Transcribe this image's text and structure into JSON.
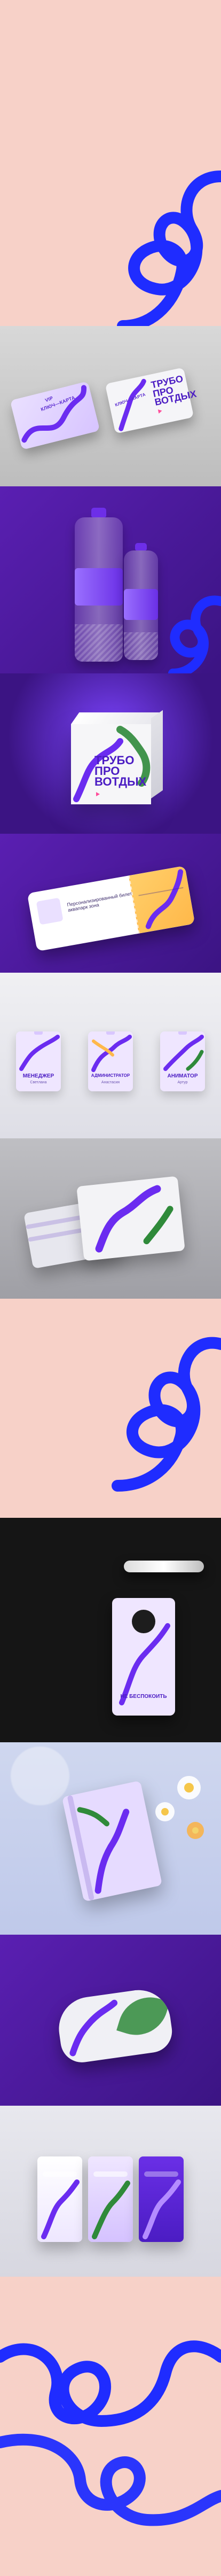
{
  "sections": {
    "cards": {
      "vip_label": "VIP",
      "key_card_label": "КЛЮЧ—КАРТА",
      "key_card_label_2": "КЛЮЧ—КАРТА",
      "brand_line1": "ТРУБО",
      "brand_line2": "ПРО",
      "brand_line3": "ВОТДЫХ"
    },
    "box": {
      "brand_line1": "ТРУБО",
      "brand_line2": "ПРО",
      "brand_line3": "ВОТДЫХ"
    },
    "ticket": {
      "text": "Персонализированный билет на аквапарк зона"
    },
    "badges": [
      {
        "role": "МЕНЕДЖЕР",
        "name": "Светлана"
      },
      {
        "role": "АДМИНИСТРАТОР",
        "name": "Анастасия"
      },
      {
        "role": "АНИМАТОР",
        "name": "Артур"
      }
    ],
    "door_hanger": {
      "text": "НЕ БЕСПОКОИТЬ"
    }
  },
  "colors": {
    "background_pink": "#f7d1c8",
    "brand_purple": "#4b1cc3",
    "squiggle_blue": "#1f2cff"
  }
}
